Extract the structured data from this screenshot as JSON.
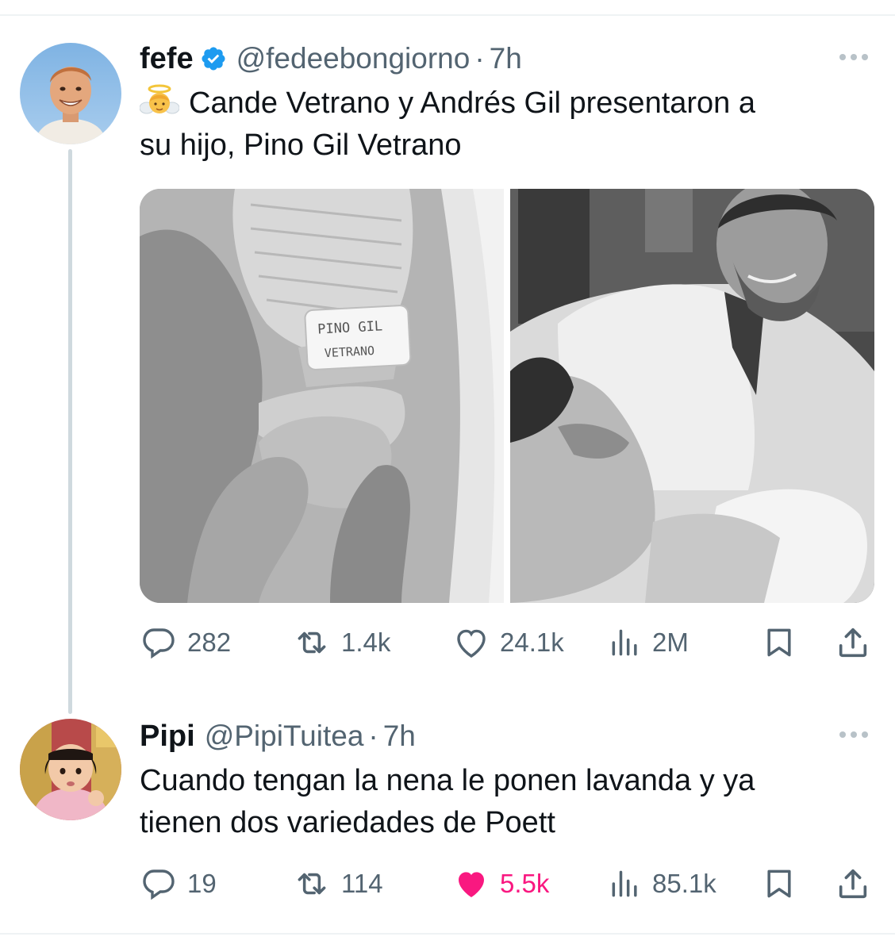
{
  "tweets": [
    {
      "display_name": "fefe",
      "verified": true,
      "handle": "@fedeebongiorno",
      "separator": "·",
      "time": "7h",
      "text_line1": "Cande Vetrano y Andrés Gil presentaron a",
      "text_line2": "su hijo, Pino Gil Vetrano",
      "emoji": "baby-angel",
      "photo_left_wristband_line1": "PINO GIL",
      "photo_left_wristband_line2": "VETRANO",
      "replies": "282",
      "retweets": "1.4k",
      "likes": "24.1k",
      "liked": false,
      "views": "2M"
    },
    {
      "display_name": "Pipi",
      "verified": false,
      "handle": "@PipiTuitea",
      "separator": "·",
      "time": "7h",
      "text_line1": "Cuando tengan la nena le ponen lavanda y ya",
      "text_line2": "tienen dos variedades de Poett",
      "replies": "19",
      "retweets": "114",
      "likes": "5.5k",
      "liked": true,
      "views": "85.1k"
    }
  ],
  "colors": {
    "text": "#0f1419",
    "secondary": "#536471",
    "verified": "#1d9bf0",
    "like": "#f91880",
    "thread_line": "#cfd9de"
  },
  "icons": [
    "more-icon",
    "verified-badge-icon",
    "reply-icon",
    "retweet-icon",
    "like-icon",
    "views-icon",
    "bookmark-icon",
    "share-icon"
  ]
}
